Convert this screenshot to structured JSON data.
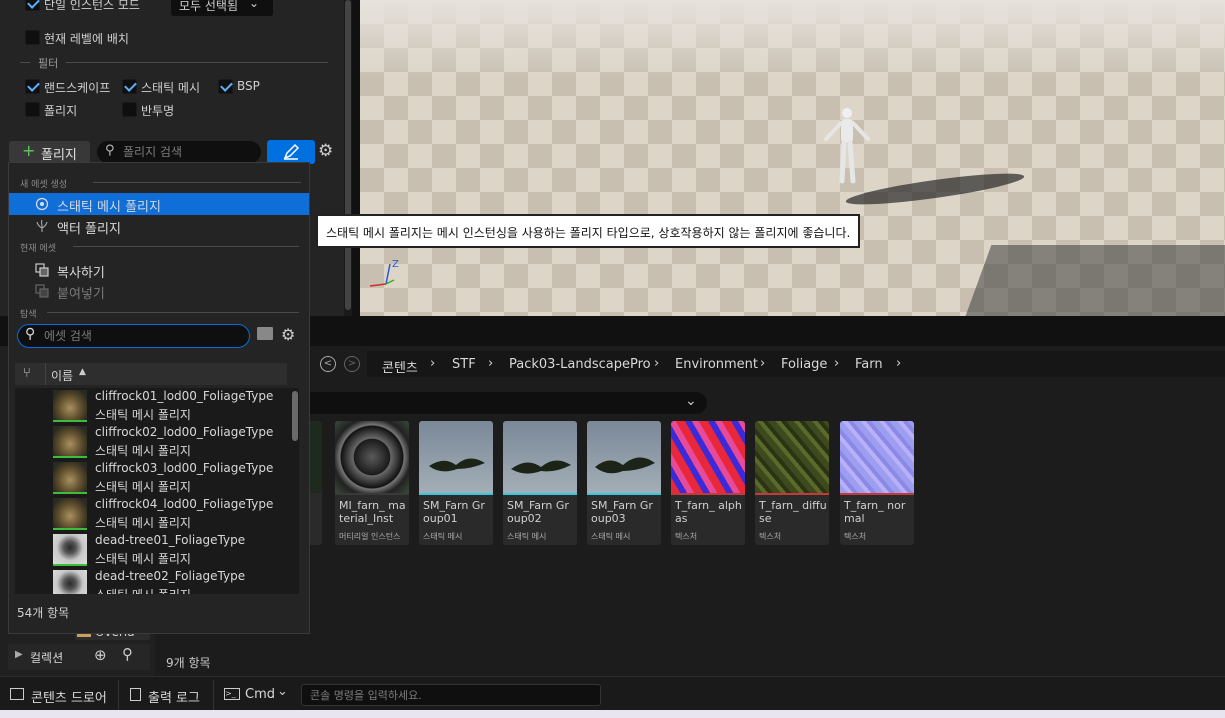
{
  "left_panel": {
    "single_instance_label": "단일 인스턴스 모드",
    "select_all_label": "모두 선택됨",
    "place_in_level_label": "현재 레벨에 배치",
    "filter_section": "필터",
    "filters": [
      {
        "label": "랜드스케이프",
        "checked": true
      },
      {
        "label": "스태틱 메시",
        "checked": true
      },
      {
        "label": "BSP",
        "checked": true
      },
      {
        "label": "폴리지",
        "checked": false
      },
      {
        "label": "반투명",
        "checked": false
      }
    ],
    "add_foliage_label": "폴리지",
    "foliage_search_placeholder": "폴리지 검색"
  },
  "tooltip": "스태틱 메시 폴리지는 메시 인스턴싱을 사용하는 폴리지 타입으로, 상호작용하지 않는 폴리지에 좋습니다.",
  "viewport": {
    "axis_z": "Z"
  },
  "popup": {
    "new_asset_header": "새 에셋 생성",
    "static_mesh_foliage": "스태틱 메시 폴리지",
    "actor_foliage": "액터 폴리지",
    "current_asset_header": "현재 에셋",
    "copy": "복사하기",
    "paste": "붙여넣기",
    "browse_header": "탐색",
    "asset_search_placeholder": "에셋 검색",
    "column_name": "이름",
    "items": [
      {
        "name": "cliffrock01_lod00_FoliageType",
        "type": "스태틱 메시 폴리지"
      },
      {
        "name": "cliffrock02_lod00_FoliageType",
        "type": "스태틱 메시 폴리지"
      },
      {
        "name": "cliffrock03_lod00_FoliageType",
        "type": "스태틱 메시 폴리지"
      },
      {
        "name": "cliffrock04_lod00_FoliageType",
        "type": "스태틱 메시 폴리지"
      },
      {
        "name": "dead-tree01_FoliageType",
        "type": "스태틱 메시 폴리지"
      },
      {
        "name": "dead-tree02_FoliageType",
        "type": "스태틱 메시 폴리지"
      }
    ],
    "item_count": "54개 항목"
  },
  "content_browser": {
    "breadcrumbs": [
      "콘텐츠",
      "STF",
      "Pack03-LandscapePro",
      "Environment",
      "Foliage",
      "Farn"
    ],
    "tiles": [
      {
        "name": "MI_farn_ material_Inst",
        "type": "머티리얼 인스턴스",
        "bar_color": "#3a3a3a"
      },
      {
        "name": "SM_Farn Group01",
        "type": "스태틱 메시",
        "bar_color": "#37c8e0"
      },
      {
        "name": "SM_Farn Group02",
        "type": "스태틱 메시",
        "bar_color": "#37c8e0"
      },
      {
        "name": "SM_Farn Group03",
        "type": "스태틱 메시",
        "bar_color": "#37c8e0"
      },
      {
        "name": "T_farn_ alphas",
        "type": "텍스처",
        "bar_color": "#c43a3a"
      },
      {
        "name": "T_farn_ diffuse",
        "type": "텍스처",
        "bar_color": "#c43a3a"
      },
      {
        "name": "T_farn_ normal",
        "type": "텍스처",
        "bar_color": "#c43a3a"
      }
    ],
    "item_count": "9개 항목",
    "collections_label": "컬렉션",
    "folder_partial": "Overla"
  },
  "bottom_bar": {
    "content_drawer": "콘텐츠 드로어",
    "output_log": "출력 로그",
    "cmd": "Cmd",
    "console_placeholder": "콘솔 명령을 입력하세요."
  },
  "colors": {
    "accent": "#0070e0",
    "selection": "#0f6ed8",
    "checkbox": "#5ab0ff"
  }
}
